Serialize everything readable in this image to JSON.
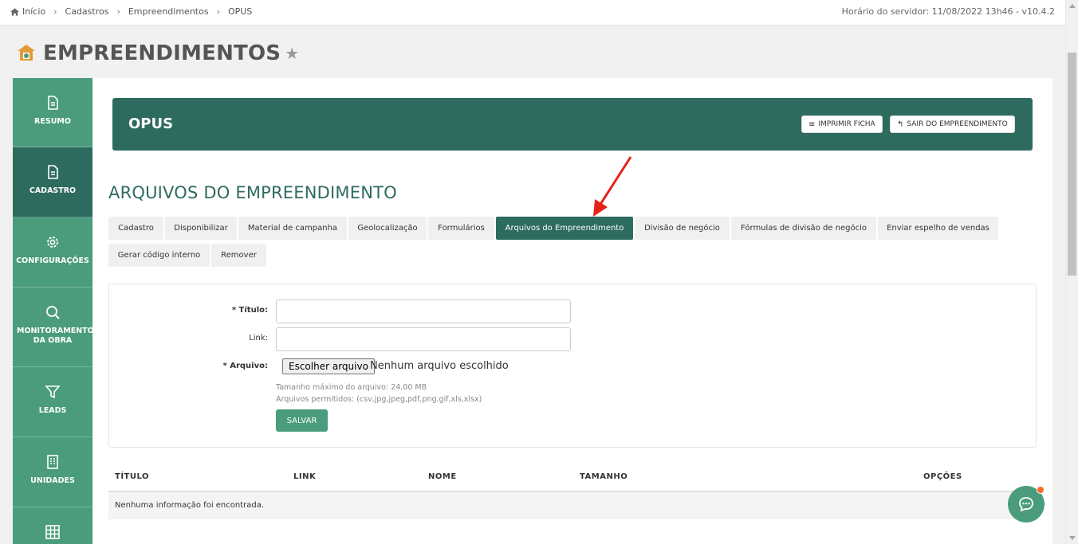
{
  "breadcrumb": {
    "items": [
      "Início",
      "Cadastros",
      "Empreendimentos",
      "OPUS"
    ]
  },
  "server_info": "Horário do servidor: 11/08/2022 13h46 - v10.4.2",
  "page": {
    "title": "EMPREENDIMENTOS"
  },
  "sidebar": {
    "items": [
      {
        "label": "RESUMO",
        "icon": "file-icon"
      },
      {
        "label": "CADASTRO",
        "icon": "file-icon",
        "active": true
      },
      {
        "label": "CONFIGURAÇÕES",
        "icon": "gear-icon"
      },
      {
        "label": "MONITORAMENTO DA OBRA",
        "icon": "search-icon"
      },
      {
        "label": "LEADS",
        "icon": "funnel-icon"
      },
      {
        "label": "UNIDADES",
        "icon": "building-icon"
      },
      {
        "label": "",
        "icon": "grid-icon"
      }
    ]
  },
  "banner": {
    "name": "OPUS",
    "print_label": "IMPRIMIR FICHA",
    "exit_label": "SAIR DO EMPREENDIMENTO"
  },
  "section": {
    "title": "ARQUIVOS DO EMPREENDIMENTO"
  },
  "tabs": [
    "Cadastro",
    "Disponibilizar",
    "Material de campanha",
    "Geolocalização",
    "Formulários",
    "Arquivos do Empreendimento",
    "Divisão de negócio",
    "Fórmulas de divisão de negócio",
    "Enviar espelho de vendas",
    "Gerar código interno",
    "Remover"
  ],
  "active_tab": "Arquivos do Empreendimento",
  "form": {
    "title_label": "* Título:",
    "link_label": "Link:",
    "file_label": "* Arquivo:",
    "file_button": "Escolher arquivo",
    "file_status": "Nenhum arquivo escolhido",
    "hint_size": "Tamanho máximo do arquivo: 24,00 MB",
    "hint_types": "Arquivos permitidos: (csv,jpg,jpeg,pdf,png,gif,xls,xlsx)",
    "save_label": "SALVAR"
  },
  "table": {
    "headers": [
      "TÍTULO",
      "LINK",
      "NOME",
      "TAMANHO",
      "OPÇÕES"
    ],
    "empty_message": "Nenhuma informação foi encontrada."
  },
  "colors": {
    "primary_dark": "#2e6b5f",
    "primary": "#4a9c7d",
    "annotation_arrow": "#e5231b",
    "notification": "#ff6b2c"
  }
}
